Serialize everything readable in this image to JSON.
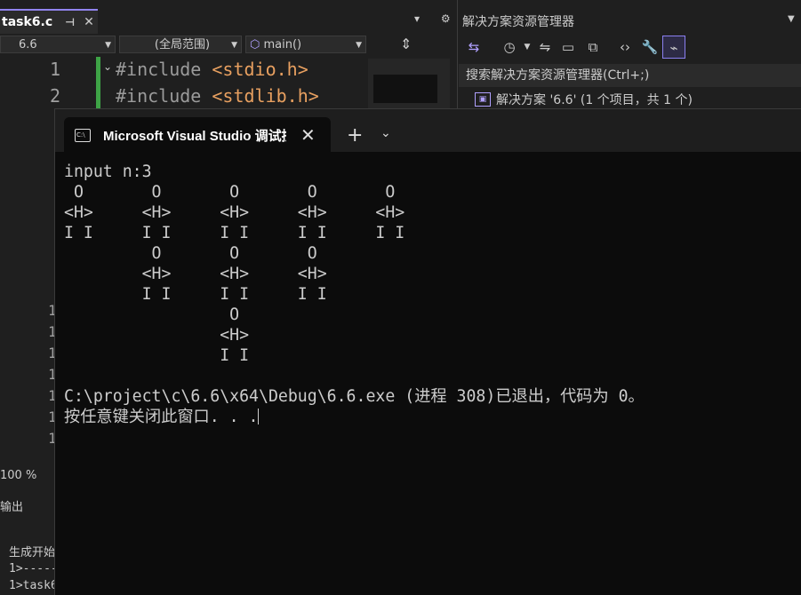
{
  "editor": {
    "tab_name": "task6.c",
    "tab_pin": "⊣",
    "tab_close": "✕",
    "tab_tools": "▾ ⚙",
    "nav": {
      "project": "6.6",
      "scope": "(全局范围)",
      "function": "main()"
    },
    "line_numbers": [
      "1",
      "2"
    ],
    "code_lines": [
      {
        "prefix": "#include ",
        "header": "<stdio.h>"
      },
      {
        "prefix": "#include ",
        "header": "<stdlib.h>"
      }
    ],
    "side_numbers": [
      "1",
      "1",
      "1",
      "1",
      "1",
      "1",
      "1"
    ],
    "zoom": "100 %",
    "output_title": "输出",
    "output_lines": [
      "生成开始",
      "1>------",
      "1>task6"
    ]
  },
  "solution_explorer": {
    "title": "解决方案资源管理器",
    "search_placeholder": "搜索解决方案资源管理器(Ctrl+;)",
    "solution_item": "解决方案 '6.6' (1 个项目，共 1 个)",
    "toolbar_icons": [
      "vs-icon",
      "history-icon",
      "sync-icon",
      "collapse-icon",
      "copy-icon",
      "code-icon",
      "wrench-icon",
      "preview-icon"
    ]
  },
  "console": {
    "tab_title": "Microsoft Visual Studio 调试控制台",
    "tab_icon_text": "C:\\",
    "new_tab": "+",
    "dropdown": "⌄",
    "output": "input n:3\n O       O       O       O       O\n<H>     <H>     <H>     <H>     <H>\nI I     I I     I I     I I     I I\n         O       O       O\n        <H>     <H>     <H>\n        I I     I I     I I\n                 O\n                <H>\n                I I\n\nC:\\project\\c\\6.6\\x64\\Debug\\6.6.exe (进程 308)已退出，代码为 0。\n按任意键关闭此窗口. . .",
    "accent": "#9184ee"
  }
}
